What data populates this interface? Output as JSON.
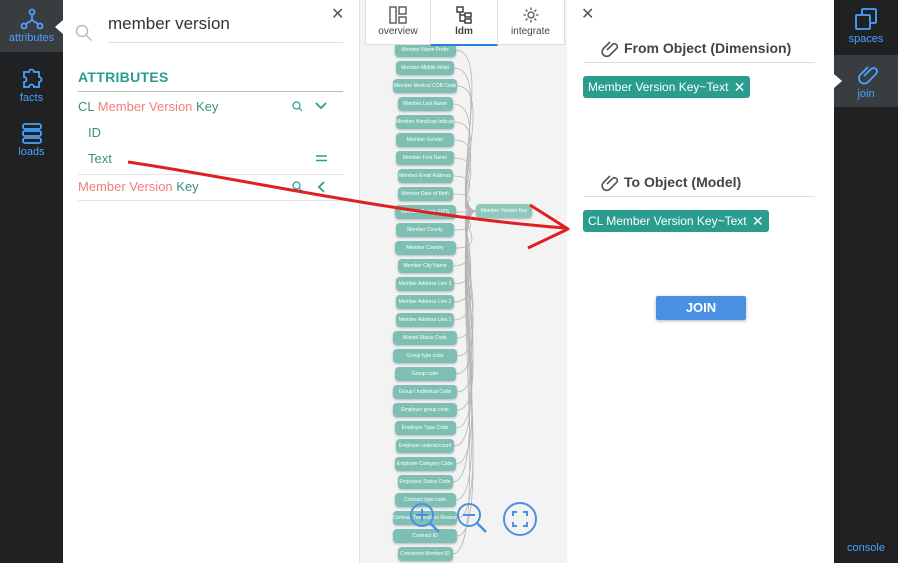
{
  "left_nav": {
    "items": [
      {
        "label": "attributes",
        "icon": "share-icon",
        "active": true
      },
      {
        "label": "facts",
        "icon": "puzzle-icon",
        "active": false
      },
      {
        "label": "loads",
        "icon": "database-icon",
        "active": false
      }
    ]
  },
  "attributes_panel": {
    "search_value": "member version",
    "section_title": "ATTRIBUTES",
    "rows": [
      {
        "prefix": "CL ",
        "highlight": "Member Version",
        "suffix": " Key"
      },
      {
        "label": "ID"
      },
      {
        "label": "Text"
      },
      {
        "prefix": "",
        "highlight": "Member Version",
        "suffix": " Key"
      }
    ]
  },
  "diagram": {
    "tabs": [
      {
        "label": "overview",
        "icon": "overview-icon"
      },
      {
        "label": "ldm",
        "icon": "ldm-icon",
        "active": true
      },
      {
        "label": "integrate",
        "icon": "gear-icon"
      }
    ],
    "nodes": [
      "Member Name Prefix",
      "Member Middle Initial",
      "Member Medical COB Code",
      "Member Last Name",
      "Member Handicap Indicator",
      "Member Gender",
      "Member First Name",
      "Member Email Address",
      "Member Date of Birth",
      "Member County FIPS",
      "Member County",
      "Member Country",
      "Member City Name",
      "Member Address Line 3",
      "Member Address Line 2",
      "Member Address Line 1",
      "Marital Status Code",
      "Group type code",
      "Group code",
      "Group / Individual Code",
      "Employer group code",
      "Employer Type Code",
      "Employer code/account",
      "Employer Category Code",
      "Employee Status Code",
      "Contract type code",
      "Contract Termination Reason",
      "Contract ID",
      "Consistent Member ID"
    ],
    "target_node": "Member Version Key"
  },
  "join_panel": {
    "from_title": "From Object (Dimension)",
    "from_chip": "Member Version Key~Text",
    "to_title": "To Object (Model)",
    "to_chip": "CL Member Version Key~Text",
    "join_button": "JOIN"
  },
  "right_nav": {
    "items": [
      {
        "label": "spaces",
        "icon": "spaces-icon"
      },
      {
        "label": "join",
        "icon": "link-icon",
        "active": true
      }
    ],
    "console": "console"
  },
  "colors": {
    "accent_teal": "#2a9d8f",
    "highlight_salmon": "#ef7f7a",
    "nav_blue": "#4aa3ff",
    "arrow_red": "#e02020",
    "button_blue": "#4a90e2"
  }
}
